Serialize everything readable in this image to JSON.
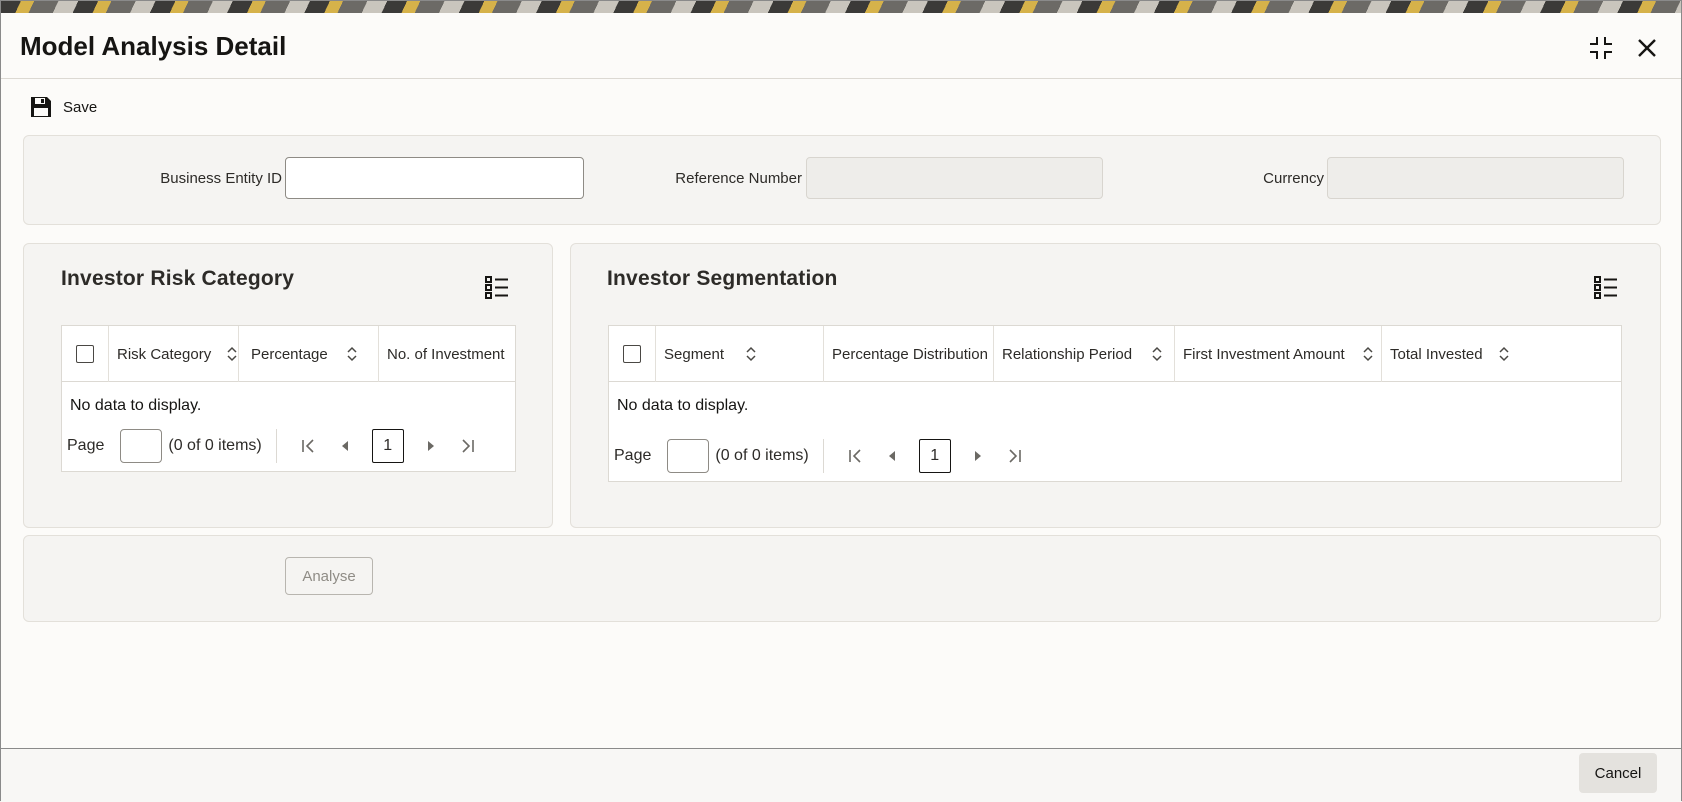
{
  "window": {
    "title": "Model Analysis Detail"
  },
  "toolbar": {
    "save_label": "Save"
  },
  "header_fields": {
    "business_entity_id": {
      "label": "Business Entity ID",
      "value": ""
    },
    "reference_number": {
      "label": "Reference Number",
      "value": ""
    },
    "currency": {
      "label": "Currency",
      "value": ""
    }
  },
  "risk_category": {
    "title": "Investor Risk Category",
    "columns": [
      "Risk Category",
      "Percentage",
      "No. of Investment"
    ],
    "rows": [],
    "empty_text": "No data to display.",
    "pager": {
      "page_label": "Page",
      "items_text": "(0 of 0 items)",
      "current_page": "1"
    }
  },
  "segmentation": {
    "title": "Investor Segmentation",
    "columns": [
      "Segment",
      "Percentage Distribution",
      "Relationship Period",
      "First Investment Amount",
      "Total Invested"
    ],
    "rows": [],
    "empty_text": "No data to display.",
    "pager": {
      "page_label": "Page",
      "items_text": "(0 of 0 items)",
      "current_page": "1"
    }
  },
  "actions": {
    "analyse_label": "Analyse",
    "cancel_label": "Cancel"
  },
  "icons": {
    "save": "save-icon",
    "maximize": "collapse-icon",
    "close": "close-icon",
    "column_list": "list-view-icon",
    "sort": "sort-icon"
  }
}
